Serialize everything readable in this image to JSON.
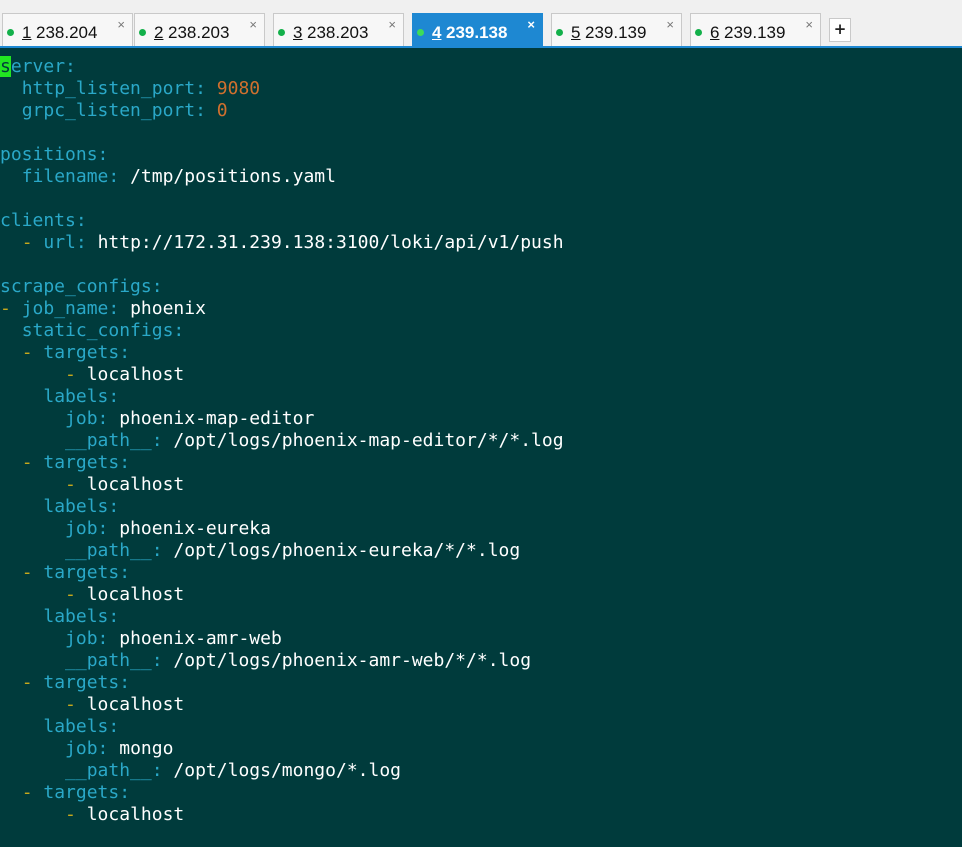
{
  "tabs": [
    {
      "num": "1",
      "host": "238.204",
      "close": "×",
      "active": false
    },
    {
      "num": "2",
      "host": "238.203",
      "close": "×",
      "active": false
    },
    {
      "num": "3",
      "host": "238.203",
      "close": "×",
      "active": false
    },
    {
      "num": "4",
      "host": "239.138",
      "close": "×",
      "active": true
    },
    {
      "num": "5",
      "host": "239.139",
      "close": "×",
      "active": false
    },
    {
      "num": "6",
      "host": "239.139",
      "close": "×",
      "active": false
    }
  ],
  "add_tab_label": "+",
  "colors": {
    "terminal_bg": "#003b3c",
    "key": "#2aa8c8",
    "dash": "#c6a81c",
    "number": "#d0702e",
    "value": "#ffffff",
    "cursor": "#22e622",
    "active_tab": "#1e88d2",
    "status_dot": "#13b04a"
  },
  "lines": [
    {
      "indent": "",
      "dash": "",
      "cursor": "s",
      "key": "erver",
      "colon": ":",
      "value": "",
      "value_type": ""
    },
    {
      "indent": "  ",
      "dash": "",
      "key": "http_listen_port",
      "colon": ":",
      "value": "9080",
      "value_type": "number"
    },
    {
      "indent": "  ",
      "dash": "",
      "key": "grpc_listen_port",
      "colon": ":",
      "value": "0",
      "value_type": "number"
    },
    {
      "indent": "",
      "dash": "",
      "key": "",
      "colon": "",
      "value": "",
      "value_type": ""
    },
    {
      "indent": "",
      "dash": "",
      "key": "positions",
      "colon": ":",
      "value": "",
      "value_type": ""
    },
    {
      "indent": "  ",
      "dash": "",
      "key": "filename",
      "colon": ":",
      "value": "/tmp/positions.yaml",
      "value_type": "string"
    },
    {
      "indent": "",
      "dash": "",
      "key": "",
      "colon": "",
      "value": "",
      "value_type": ""
    },
    {
      "indent": "",
      "dash": "",
      "key": "clients",
      "colon": ":",
      "value": "",
      "value_type": ""
    },
    {
      "indent": "  ",
      "dash": "-",
      "key": "url",
      "colon": ":",
      "value": "http://172.31.239.138:3100/loki/api/v1/push",
      "value_type": "string"
    },
    {
      "indent": "",
      "dash": "",
      "key": "",
      "colon": "",
      "value": "",
      "value_type": ""
    },
    {
      "indent": "",
      "dash": "",
      "key": "scrape_configs",
      "colon": ":",
      "value": "",
      "value_type": ""
    },
    {
      "indent": "",
      "dash": "-",
      "key": "job_name",
      "colon": ":",
      "value": "phoenix",
      "value_type": "string"
    },
    {
      "indent": "  ",
      "dash": "",
      "key": "static_configs",
      "colon": ":",
      "value": "",
      "value_type": ""
    },
    {
      "indent": "  ",
      "dash": "-",
      "key": "targets",
      "colon": ":",
      "value": "",
      "value_type": ""
    },
    {
      "indent": "      ",
      "dash": "-",
      "key": "",
      "colon": "",
      "value": "localhost",
      "value_type": "string"
    },
    {
      "indent": "    ",
      "dash": "",
      "key": "labels",
      "colon": ":",
      "value": "",
      "value_type": ""
    },
    {
      "indent": "      ",
      "dash": "",
      "key": "job",
      "colon": ":",
      "value": "phoenix-map-editor",
      "value_type": "string"
    },
    {
      "indent": "      ",
      "dash": "",
      "key": "__path__",
      "colon": ":",
      "value": "/opt/logs/phoenix-map-editor/*/*.log",
      "value_type": "string"
    },
    {
      "indent": "  ",
      "dash": "-",
      "key": "targets",
      "colon": ":",
      "value": "",
      "value_type": ""
    },
    {
      "indent": "      ",
      "dash": "-",
      "key": "",
      "colon": "",
      "value": "localhost",
      "value_type": "string"
    },
    {
      "indent": "    ",
      "dash": "",
      "key": "labels",
      "colon": ":",
      "value": "",
      "value_type": ""
    },
    {
      "indent": "      ",
      "dash": "",
      "key": "job",
      "colon": ":",
      "value": "phoenix-eureka",
      "value_type": "string"
    },
    {
      "indent": "      ",
      "dash": "",
      "key": "__path__",
      "colon": ":",
      "value": "/opt/logs/phoenix-eureka/*/*.log",
      "value_type": "string"
    },
    {
      "indent": "  ",
      "dash": "-",
      "key": "targets",
      "colon": ":",
      "value": "",
      "value_type": ""
    },
    {
      "indent": "      ",
      "dash": "-",
      "key": "",
      "colon": "",
      "value": "localhost",
      "value_type": "string"
    },
    {
      "indent": "    ",
      "dash": "",
      "key": "labels",
      "colon": ":",
      "value": "",
      "value_type": ""
    },
    {
      "indent": "      ",
      "dash": "",
      "key": "job",
      "colon": ":",
      "value": "phoenix-amr-web",
      "value_type": "string"
    },
    {
      "indent": "      ",
      "dash": "",
      "key": "__path__",
      "colon": ":",
      "value": "/opt/logs/phoenix-amr-web/*/*.log",
      "value_type": "string"
    },
    {
      "indent": "  ",
      "dash": "-",
      "key": "targets",
      "colon": ":",
      "value": "",
      "value_type": ""
    },
    {
      "indent": "      ",
      "dash": "-",
      "key": "",
      "colon": "",
      "value": "localhost",
      "value_type": "string"
    },
    {
      "indent": "    ",
      "dash": "",
      "key": "labels",
      "colon": ":",
      "value": "",
      "value_type": ""
    },
    {
      "indent": "      ",
      "dash": "",
      "key": "job",
      "colon": ":",
      "value": "mongo",
      "value_type": "string"
    },
    {
      "indent": "      ",
      "dash": "",
      "key": "__path__",
      "colon": ":",
      "value": "/opt/logs/mongo/*.log",
      "value_type": "string"
    },
    {
      "indent": "  ",
      "dash": "-",
      "key": "targets",
      "colon": ":",
      "value": "",
      "value_type": ""
    },
    {
      "indent": "      ",
      "dash": "-",
      "key": "",
      "colon": "",
      "value": "localhost",
      "value_type": "string"
    }
  ]
}
